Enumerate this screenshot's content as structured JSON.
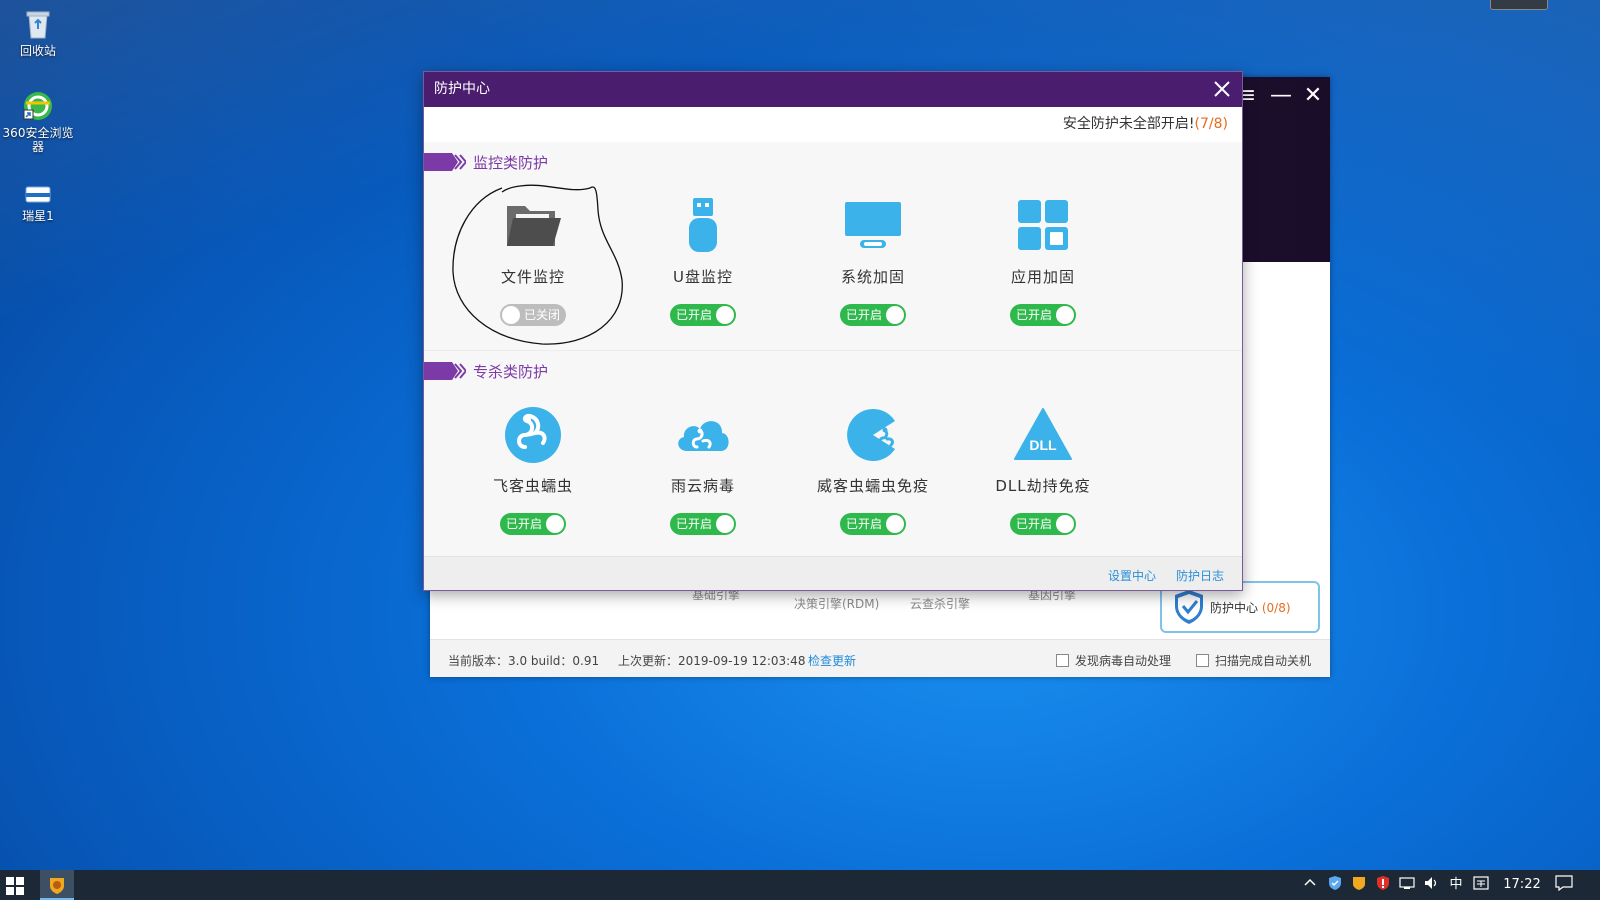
{
  "desktop": {
    "icons": [
      {
        "label": "回收站",
        "icon": "recycle-bin-icon"
      },
      {
        "label": "360安全浏览器",
        "icon": "browser-360-icon"
      },
      {
        "label": "瑞星1",
        "icon": "rising-shortcut-icon"
      }
    ]
  },
  "main_window": {
    "engines": [
      "基础引擎",
      "决策引擎(RDM)",
      "云查杀引擎",
      "基因引擎"
    ],
    "protection_center_label": "防护中心",
    "protection_center_count": "(0/8)",
    "version": "当前版本：3.0   build：0.91",
    "last_update": "上次更新：2019-09-19 12:03:48",
    "check_update": "检查更新",
    "auto_handle_virus": "发现病毒自动处理",
    "auto_shutdown": "扫描完成自动关机"
  },
  "dialog": {
    "title": "防护中心",
    "status_text": "安全防护未全部开启!",
    "status_count": "(7/8)",
    "sections": [
      {
        "title": "监控类防护",
        "items": [
          {
            "name": "文件监控",
            "icon": "folder-icon",
            "state": "off",
            "state_label": "已关闭"
          },
          {
            "name": "U盘监控",
            "icon": "usb-drive-icon",
            "state": "on",
            "state_label": "已开启"
          },
          {
            "name": "系统加固",
            "icon": "monitor-icon",
            "state": "on",
            "state_label": "已开启"
          },
          {
            "name": "应用加固",
            "icon": "app-grid-icon",
            "state": "on",
            "state_label": "已开启"
          }
        ]
      },
      {
        "title": "专杀类防护",
        "items": [
          {
            "name": "飞客虫蠕虫",
            "icon": "worm-icon",
            "state": "on",
            "state_label": "已开启"
          },
          {
            "name": "雨云病毒",
            "icon": "cloud-virus-icon",
            "state": "on",
            "state_label": "已开启"
          },
          {
            "name": "威客虫蠕虫免疫",
            "icon": "pacman-worm-icon",
            "state": "on",
            "state_label": "已开启"
          },
          {
            "name": "DLL劫持免疫",
            "icon": "dll-triangle-icon",
            "state": "on",
            "state_label": "已开启",
            "icon_text": "DLL"
          }
        ]
      }
    ],
    "footer": {
      "settings": "设置中心",
      "log": "防护日志"
    }
  },
  "taskbar": {
    "ime": "中",
    "time": "17:22"
  },
  "colors": {
    "title_bar": "#4b1d6e",
    "section_title": "#7b3aa6",
    "toggle_on": "#2fb84b",
    "toggle_off": "#bdbdbd",
    "icon_blue": "#3bb3ea",
    "accent_orange": "#e86d1f",
    "link_blue": "#2a8fd8"
  }
}
